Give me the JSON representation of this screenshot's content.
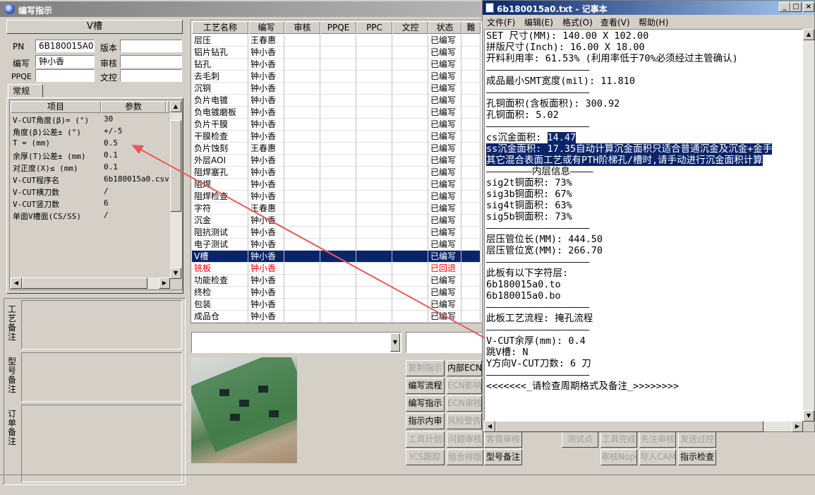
{
  "main_window": {
    "title": "编写指示",
    "section_title": "V槽",
    "fields": {
      "pn_label": "PN",
      "pn_value": "6B180015A0",
      "version_label": "版本",
      "version_value": "",
      "writer_label": "编写",
      "writer_value": "钟小香",
      "review_label": "审核",
      "review_value": "",
      "ppqe_label": "PPQE",
      "ppqe_value": "",
      "proof_label": "文控",
      "proof_value": ""
    },
    "tab": "常规",
    "param_table": {
      "headers": [
        "项目",
        "参数"
      ],
      "rows": [
        {
          "item": "V-CUT角度(β)= (°)",
          "value": "30"
        },
        {
          "item": "角度(β)公差± (°)",
          "value": "+/-5"
        },
        {
          "item": "T = (mm)",
          "value": "0.5"
        },
        {
          "item": "余厚(T)公差± (mm)",
          "value": "0.1"
        },
        {
          "item": "对正度(X)≤ (mm)",
          "value": "0.1"
        },
        {
          "item": "V-CUT程序名",
          "value": "6b180015a0.csv"
        },
        {
          "item": "V-CUT横刀数",
          "value": "/"
        },
        {
          "item": "V-CUT竖刀数",
          "value": "6"
        },
        {
          "item": "单面V槽面(CS/SS)",
          "value": "/"
        }
      ]
    },
    "notes": {
      "process_note": "工艺备注",
      "model_note": "型号备注",
      "order_note": "订单备注"
    },
    "process_table": {
      "headers": [
        "工艺名称",
        "编写",
        "审核",
        "PPQE",
        "PPC",
        "文控",
        "状态",
        "難"
      ],
      "rows": [
        {
          "name": "层压",
          "writer": "王春惠",
          "status": "已编写"
        },
        {
          "name": "铝片钻孔",
          "writer": "钟小香",
          "status": "已编写"
        },
        {
          "name": "钻孔",
          "writer": "钟小香",
          "status": "已编写"
        },
        {
          "name": "去毛刺",
          "writer": "钟小香",
          "status": "已编写"
        },
        {
          "name": "沉铜",
          "writer": "钟小香",
          "status": "已编写"
        },
        {
          "name": "负片电镀",
          "writer": "钟小香",
          "status": "已编写"
        },
        {
          "name": "负电镀磨板",
          "writer": "钟小香",
          "status": "已编写"
        },
        {
          "name": "负片干膜",
          "writer": "钟小香",
          "status": "已编写"
        },
        {
          "name": "干膜检查",
          "writer": "钟小香",
          "status": "已编写"
        },
        {
          "name": "负片蚀刻",
          "writer": "王春惠",
          "status": "已编写"
        },
        {
          "name": "外层AOI",
          "writer": "钟小香",
          "status": "已编写"
        },
        {
          "name": "阻焊塞孔",
          "writer": "钟小香",
          "status": "已编写"
        },
        {
          "name": "阻焊",
          "writer": "钟小香",
          "status": "已编写"
        },
        {
          "name": "阻焊检查",
          "writer": "钟小香",
          "status": "已编写"
        },
        {
          "name": "字符",
          "writer": "王春惠",
          "status": "已编写"
        },
        {
          "name": "沉金",
          "writer": "钟小香",
          "status": "已编写"
        },
        {
          "name": "阻抗测试",
          "writer": "钟小香",
          "status": "已编写"
        },
        {
          "name": "电子测试",
          "writer": "钟小香",
          "status": "已编写"
        },
        {
          "name": "V槽",
          "writer": "钟小香",
          "status": "已编写",
          "selected": true
        },
        {
          "name": "铣板",
          "writer": "钟小香",
          "status": "已回退",
          "returned": true
        },
        {
          "name": "功能检查",
          "writer": "钟小香",
          "status": "已编写"
        },
        {
          "name": "终检",
          "writer": "钟小香",
          "status": "已编写"
        },
        {
          "name": "包装",
          "writer": "钟小香",
          "status": "已编写"
        },
        {
          "name": "成品仓",
          "writer": "钟小香",
          "status": "已编写"
        }
      ]
    },
    "buttons": {
      "copy_instr": "复制指示",
      "internal_ecn": "内部ECN",
      "write_flow": "编写流程",
      "ecn_impact": "ECN影响",
      "write_instr": "编写指示",
      "ecn_review": "ECN审核",
      "instr_content": "指示内审",
      "risk_alert": "风险警告",
      "tool_plan": "工具计划",
      "issue_review": "问题审核",
      "customer_review": "客需审核",
      "test_point": "测试点",
      "tool_done": "工具完成",
      "preflow_review": "先注审核",
      "send_filter": "发送过控",
      "ics_track": "ICS跟踪",
      "combo_layout": "组合排版",
      "model_note": "型号备注",
      "review_nope": "审核Nope",
      "import_cam": "导入CAM",
      "instr_check": "指示检查"
    }
  },
  "notepad": {
    "title": "6b180015a0.txt - 记事本",
    "menu": [
      "文件(F)",
      "编辑(E)",
      "格式(O)",
      "查看(V)",
      "帮助(H)"
    ],
    "lines": [
      "SET 尺寸(MM): 140.00 X 102.00",
      "拼版尺寸(Inch): 16.00 X 18.00",
      "开料利用率: 61.53% (利用率低于70%必须经过主管确认)",
      "——————————————————",
      "成品最小SMT宽度(mil): 11.810",
      "——————————————————",
      "孔铜面积(含板面积): 300.92",
      "孔铜面积: 5.02",
      "——————————————————",
      "cs沉金面积: ",
      "ss沉金面积: 17.35自动计算沉金面积只适合普通沉金及沉金+金手",
      "其它混合表面工艺或有PTH阶梯孔/槽时,请手动进行沉金面积计算",
      "————————内层信息————",
      "sig2t铜面积: 73%",
      "sig3b铜面积: 67%",
      "sig4t铜面积: 63%",
      "sig5b铜面积: 73%",
      "——————————————————",
      "层压管位长(MM): 444.50",
      "层压管位宽(MM): 266.70",
      "——————————————————",
      "此板有以下字符层:",
      "6b180015a0.to",
      "6b180015a0.bo",
      "——————————————————",
      "此板工艺流程: 掩孔流程",
      "——————————————————",
      "V-CUT余厚(mm): 0.4",
      "跳V槽: N",
      "Y方向V-CUT刀数: 6 刀",
      "——————————————————",
      "<<<<<<<_请检查周期格式及备注_>>>>>>>>"
    ],
    "cs_value": "14.47",
    "min_btn": "_",
    "max_btn": "□",
    "close_btn": "×"
  },
  "colors": {
    "selection": "#0a246a",
    "returned": "#ff0000",
    "arrow": "#e85a5a"
  }
}
